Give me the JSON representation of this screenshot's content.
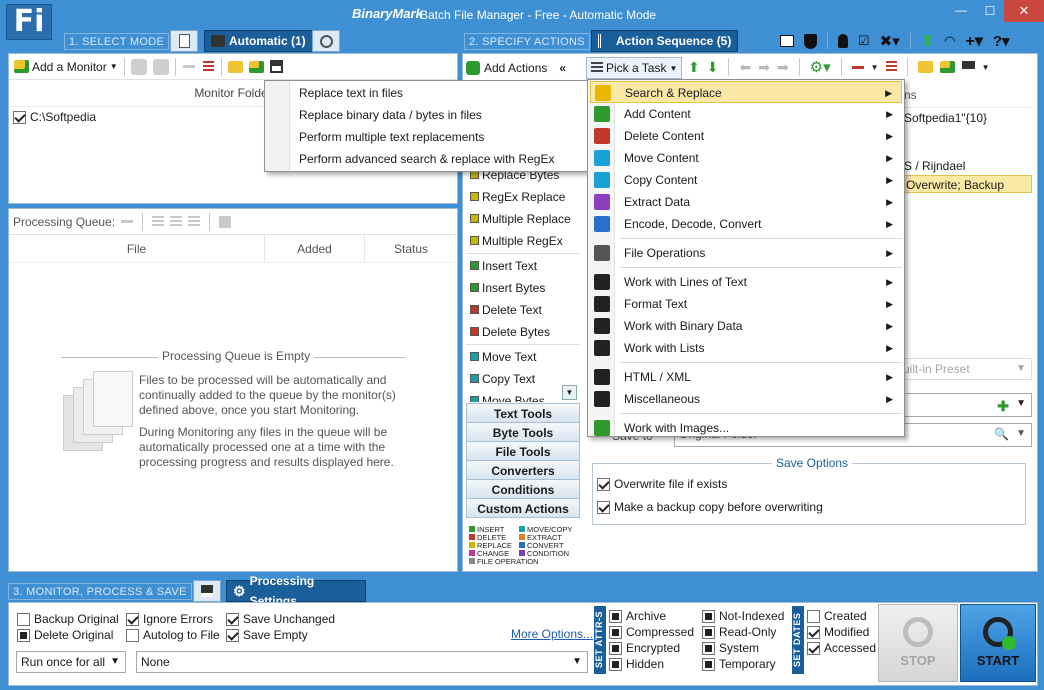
{
  "titlebar": {
    "logo": "Fi",
    "brand": "BinaryMark",
    "title": "Batch File Manager - Free - Automatic Mode",
    "minimize": "—",
    "maximize": "☐",
    "close": "✕"
  },
  "step1": {
    "label": "1. SELECT MODE",
    "automatic_tab": "Automatic (1)"
  },
  "step2": {
    "label": "2. SPECIFY ACTIONS",
    "action_seq_tab": "Action Sequence (5)"
  },
  "step3": {
    "label": "3. MONITOR, PROCESS & SAVE",
    "processing_tab": "Processing Settings"
  },
  "monitor": {
    "add_label": "Add a Monitor",
    "column": "Monitor Folder",
    "folder": "C:\\Softpedia"
  },
  "queue": {
    "title": "Processing Queue:",
    "columns": [
      "File",
      "Added",
      "Status"
    ],
    "empty_title": "Processing Queue is Empty",
    "empty_p1": "Files to be processed will be automatically and continually added to the queue by the monitor(s) defined above, once you start Monitoring.",
    "empty_p2": "During Monitoring any files in the queue will be automatically processed one at a time with the processing progress and results displayed here."
  },
  "actions": {
    "add_actions": "Add Actions",
    "collapse": "«",
    "pick_task": "Pick a Task",
    "list": [
      {
        "label": "Replace Bytes",
        "color": "#c8b800"
      },
      {
        "label": "RegEx Replace",
        "color": "#c8b800"
      },
      {
        "label": "Multiple Replace",
        "color": "#c8b800"
      },
      {
        "label": "Multiple RegEx",
        "color": "#c8b800"
      },
      {
        "label": "Insert Text",
        "color": "#2e9a2e"
      },
      {
        "label": "Insert Bytes",
        "color": "#2e9a2e"
      },
      {
        "label": "Delete Text",
        "color": "#c0392b"
      },
      {
        "label": "Delete Bytes",
        "color": "#c0392b"
      },
      {
        "label": "Move Text",
        "color": "#1aa0a8"
      },
      {
        "label": "Copy Text",
        "color": "#1aa0a8"
      },
      {
        "label": "Move Bytes",
        "color": "#1aa0a8"
      }
    ],
    "categories": [
      "Text Tools",
      "Byte Tools",
      "File Tools",
      "Converters",
      "Conditions",
      "Custom Actions"
    ],
    "legend": [
      {
        "label": "INSERT",
        "color": "#2e9a2e"
      },
      {
        "label": "MOVE/COPY",
        "color": "#1aa0a8"
      },
      {
        "label": "DELETE",
        "color": "#c0392b"
      },
      {
        "label": "EXTRACT",
        "color": "#e67e22"
      },
      {
        "label": "REPLACE",
        "color": "#c8b800"
      },
      {
        "label": "CONVERT",
        "color": "#2a6fc9"
      },
      {
        "label": "CHANGE",
        "color": "#c0399b"
      },
      {
        "label": "CONDITION",
        "color": "#7d3cc0"
      },
      {
        "label": "FILE OPERATION",
        "color": "#888888"
      }
    ]
  },
  "sequence": {
    "header_partial": "ns",
    "rows": [
      "Softpedia1\"{10}",
      "",
      "S / Rijndael",
      "Overwrite; Backup"
    ],
    "preset": "uilt-in Preset",
    "save_to_value": "Original Folder",
    "save_to_label": "Save to",
    "save_options_title": "Save Options",
    "overwrite": "Overwrite file if exists",
    "backup": "Make a backup copy before overwriting"
  },
  "submenu": {
    "items": [
      "Replace text in files",
      "Replace binary data / bytes in files",
      "Perform multiple text replacements",
      "Perform advanced search & replace with RegEx"
    ]
  },
  "taskmenu": {
    "items": [
      {
        "label": "Search & Replace",
        "icon": "search-replace-icon",
        "color": "#e8b800",
        "hl": true
      },
      {
        "label": "Add Content",
        "icon": "add-content-icon",
        "color": "#2e9a2e"
      },
      {
        "label": "Delete Content",
        "icon": "delete-content-icon",
        "color": "#c0392b"
      },
      {
        "label": "Move Content",
        "icon": "move-content-icon",
        "color": "#1aa0d8"
      },
      {
        "label": "Copy Content",
        "icon": "copy-content-icon",
        "color": "#1aa0d8"
      },
      {
        "label": "Extract Data",
        "icon": "extract-data-icon",
        "color": "#8e3cc0"
      },
      {
        "label": "Encode, Decode, Convert",
        "icon": "convert-icon",
        "color": "#2a6fc9",
        "sep_after": true
      },
      {
        "label": "File Operations",
        "icon": "file-operations-icon",
        "color": "#555555",
        "sep_after": true
      },
      {
        "label": "Work with Lines of Text",
        "icon": "lines-icon",
        "color": "#222222"
      },
      {
        "label": "Format Text",
        "icon": "format-text-icon",
        "color": "#222222"
      },
      {
        "label": "Work with Binary Data",
        "icon": "binary-icon",
        "color": "#222222"
      },
      {
        "label": "Work with Lists",
        "icon": "lists-icon",
        "color": "#222222",
        "sep_after": true
      },
      {
        "label": "HTML / XML",
        "icon": "html-icon",
        "color": "#222222"
      },
      {
        "label": "Miscellaneous",
        "icon": "misc-icon",
        "color": "#222222",
        "sep_after": true
      },
      {
        "label": "Work with Images...",
        "icon": "images-icon",
        "color": "#2e9a2e",
        "noarrow": true
      }
    ]
  },
  "settings": {
    "backup_original": "Backup Original",
    "delete_original": "Delete Original",
    "ignore_errors": "Ignore Errors",
    "autolog": "Autolog to File",
    "save_unchanged": "Save Unchanged",
    "save_empty": "Save Empty",
    "run_once": "Run once for all",
    "none": "None",
    "more_options": "More Options...",
    "attr_label": "SET ATTR-S",
    "attrs": [
      "Archive",
      "Compressed",
      "Encrypted",
      "Hidden",
      "Not-Indexed",
      "Read-Only",
      "System",
      "Temporary"
    ],
    "dates_label": "SET DATES",
    "dates": [
      "Created",
      "Modified",
      "Accessed"
    ],
    "stop": "STOP",
    "start": "START"
  }
}
